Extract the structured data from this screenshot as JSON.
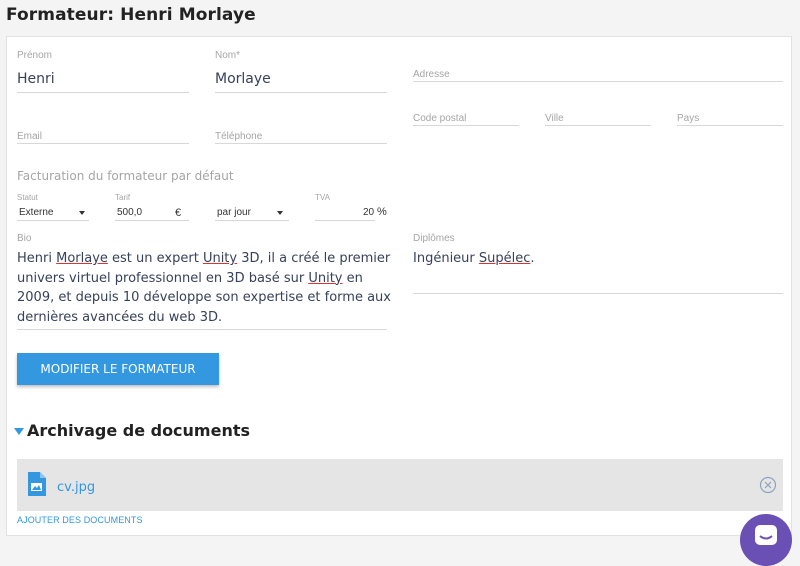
{
  "page_title": "Formateur: Henri Morlaye",
  "form": {
    "prenom": {
      "label": "Prénom",
      "value": "Henri"
    },
    "nom": {
      "label": "Nom*",
      "value": "Morlaye"
    },
    "adresse": {
      "label": "Adresse",
      "value": ""
    },
    "code_postal": {
      "label": "Code postal",
      "value": ""
    },
    "ville": {
      "label": "Ville",
      "value": ""
    },
    "pays": {
      "label": "Pays",
      "value": ""
    },
    "email": {
      "label": "Email",
      "value": ""
    },
    "telephone": {
      "label": "Téléphone",
      "value": ""
    }
  },
  "facturation": {
    "title": "Facturation du formateur par défaut",
    "statut": {
      "label": "Statut",
      "value": "Externe"
    },
    "tarif": {
      "label": "Tarif",
      "value": "500,0",
      "unit": "€"
    },
    "periode": {
      "value": "par jour"
    },
    "tva": {
      "label": "TVA",
      "value": "20",
      "unit": "%"
    }
  },
  "bio": {
    "label": "Bio",
    "parts": [
      "Henri ",
      "Morlaye",
      " est un expert ",
      "Unity",
      " 3D, il a créé le premier univers virtuel professionnel en 3D basé sur ",
      "Unity",
      " en 2009, et depuis 10 développe son expertise et forme aux dernières avancées du web 3D."
    ]
  },
  "diplomes": {
    "label": "Diplômes",
    "parts": [
      "Ingénieur ",
      "Supélec",
      "."
    ]
  },
  "submit_button": {
    "label": "MODIFIER LE FORMATEUR"
  },
  "archivage": {
    "title": "Archivage de documents",
    "documents": [
      {
        "name": "cv.jpg"
      }
    ],
    "add_label": "AJOUTER DES DOCUMENTS"
  },
  "colors": {
    "accent": "#3398e0",
    "chat": "#6a4fb5",
    "text": "#37415a",
    "label": "#a5a5a5"
  },
  "icons": {
    "file": "image-file-icon",
    "remove": "circle-x-icon",
    "chat": "chat-icon",
    "collapse": "caret-down-icon"
  }
}
